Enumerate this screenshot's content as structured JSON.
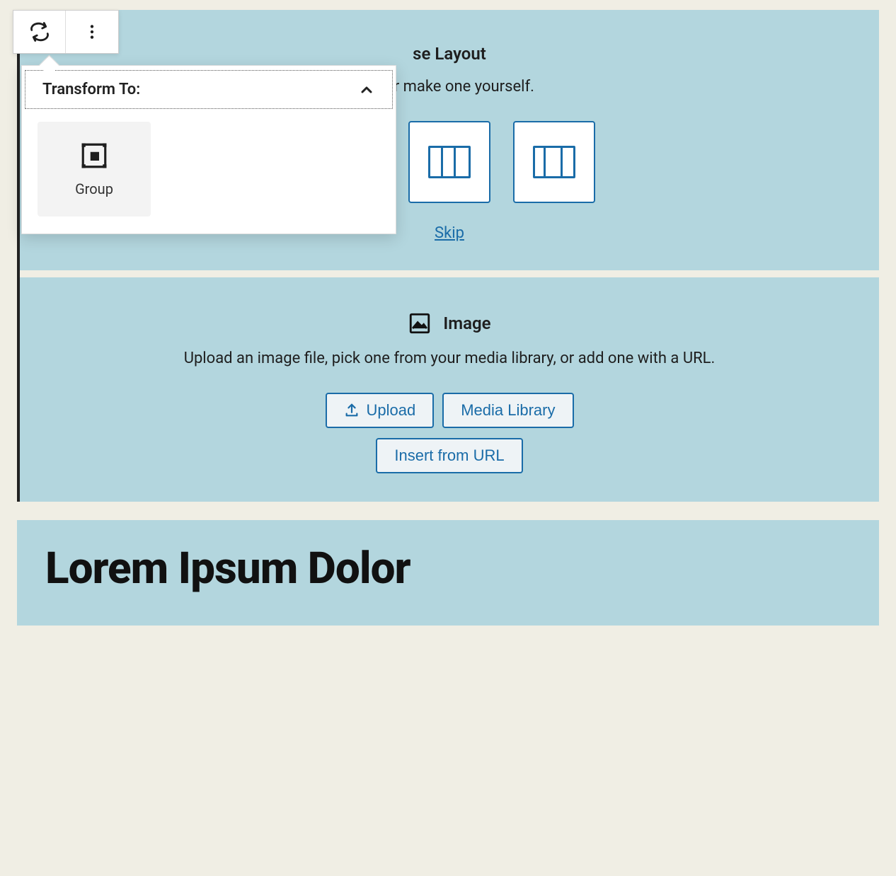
{
  "toolbar": {
    "transform_icon": "transform-icon",
    "more_icon": "more-options-icon"
  },
  "popover": {
    "title": "Transform To:",
    "option_group": "Group"
  },
  "columns_block": {
    "title_suffix": "se Layout",
    "desc_suffix": "th, or make one yourself.",
    "skip": "Skip"
  },
  "image_block": {
    "title": "Image",
    "desc": "Upload an image file, pick one from your media library, or add one with a URL.",
    "upload": "Upload",
    "media_library": "Media Library",
    "insert_url": "Insert from URL"
  },
  "heading": {
    "text": "Lorem Ipsum Dolor"
  }
}
